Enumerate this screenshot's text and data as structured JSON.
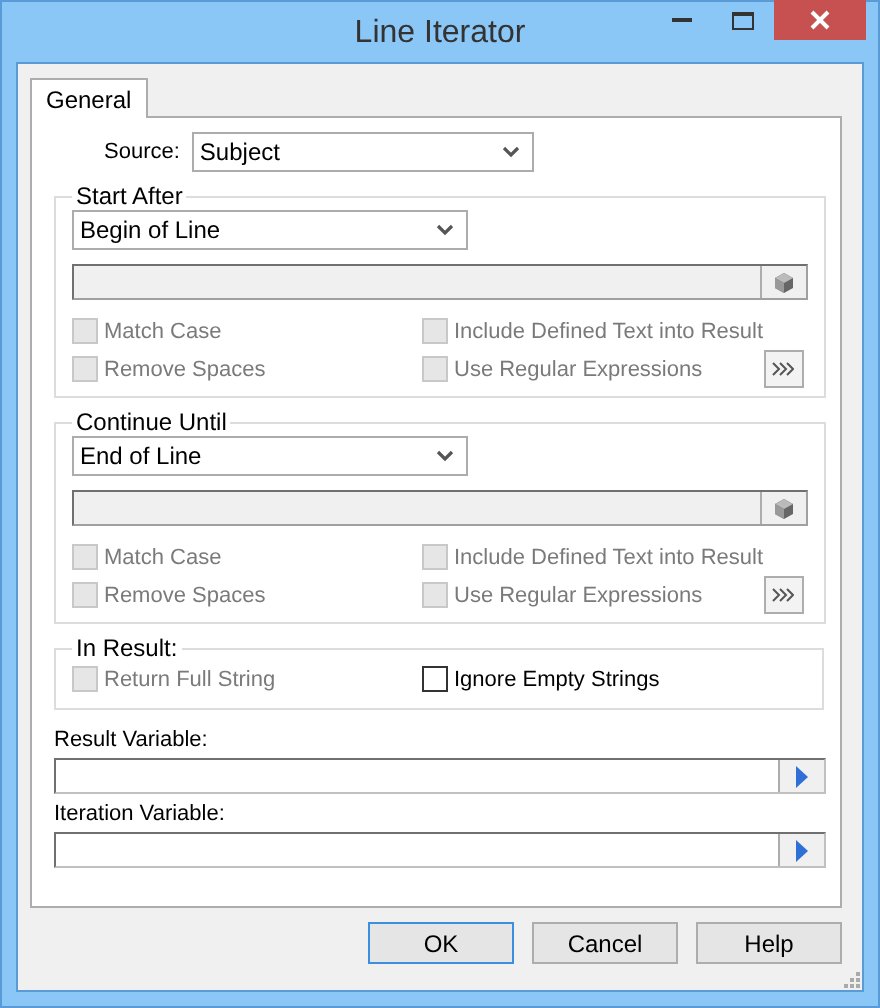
{
  "window": {
    "title": "Line Iterator"
  },
  "tabs": [
    {
      "label": "General",
      "selected": true
    }
  ],
  "source": {
    "label": "Source:",
    "value": "Subject"
  },
  "groups": [
    {
      "title": "Start After",
      "combo": "Begin of Line",
      "options": [
        {
          "label": "Match Case",
          "checked": false,
          "disabled": true
        },
        {
          "label": "Include Defined Text into Result",
          "checked": false,
          "disabled": true
        },
        {
          "label": "Remove Spaces",
          "checked": false,
          "disabled": true
        },
        {
          "label": "Use Regular Expressions",
          "checked": false,
          "disabled": true
        }
      ]
    },
    {
      "title": "Continue Until",
      "combo": "End of Line",
      "options": [
        {
          "label": "Match Case",
          "checked": false,
          "disabled": true
        },
        {
          "label": "Include Defined Text into Result",
          "checked": false,
          "disabled": true
        },
        {
          "label": "Remove Spaces",
          "checked": false,
          "disabled": true
        },
        {
          "label": "Use Regular Expressions",
          "checked": false,
          "disabled": true
        }
      ]
    }
  ],
  "in_result": {
    "title": "In Result:",
    "options": [
      {
        "label": "Return Full String",
        "checked": false,
        "disabled": true
      },
      {
        "label": "Ignore Empty Strings",
        "checked": false,
        "disabled": false
      }
    ]
  },
  "variables": [
    {
      "label": "Result Variable:"
    },
    {
      "label": "Iteration Variable:"
    }
  ],
  "buttons": [
    {
      "label": "OK",
      "default": true
    },
    {
      "label": "Cancel",
      "default": false
    },
    {
      "label": "Help",
      "default": false
    }
  ]
}
